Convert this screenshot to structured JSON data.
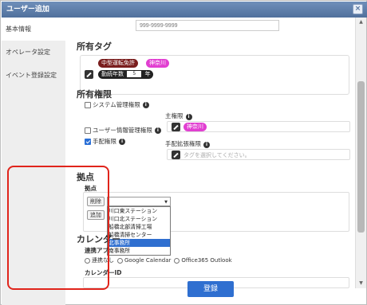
{
  "window": {
    "title": "ユーザー追加",
    "close_label": "×"
  },
  "sidebar": {
    "items": [
      {
        "label": "基本情報",
        "active": true
      },
      {
        "label": "オペレータ設定",
        "active": false
      },
      {
        "label": "イベント登録設定",
        "active": false
      }
    ]
  },
  "phone": {
    "placeholder": "999-9999-9999"
  },
  "owned_tags": {
    "title": "所有タグ",
    "tags": [
      "中型運転免許",
      "神奈川"
    ],
    "years_label": "勤続年数",
    "years_value": "5",
    "years_unit": "年"
  },
  "permissions": {
    "title": "所有権限",
    "items": [
      {
        "label": "システム管理権限",
        "checked": false
      },
      {
        "label": "ユーザー情報管理権限",
        "checked": false
      },
      {
        "label": "手配権限",
        "checked": true
      }
    ],
    "main_perm_label": "主権限",
    "main_perm_tag": "神奈川",
    "sub_perm_label": "手配拡張権限",
    "sub_perm_placeholder": "タグを選択してください。"
  },
  "kyoten": {
    "section_title": "拠点",
    "field_label": "拠点",
    "delete_label": "削除",
    "add_label": "追加",
    "options": [
      "川口東ステーション",
      "川口北ステーション",
      "船橋北部清掃工場",
      "船橋清掃センター",
      "北事務所",
      "南事務所"
    ],
    "selected_index": 4
  },
  "calendar": {
    "section_title": "カレンダー",
    "link_label": "連携アプ",
    "radio_labels": [
      "連携なし",
      "Google Calendar",
      "Office365 Outlook"
    ],
    "id_label": "カレンダーID"
  },
  "footer": {
    "register_label": "登録"
  },
  "colors": {
    "accent": "#2f6fd0",
    "highlight_red": "#e0241b",
    "tag_pink": "#e13fd1",
    "tag_dark": "#7a1e1e"
  }
}
